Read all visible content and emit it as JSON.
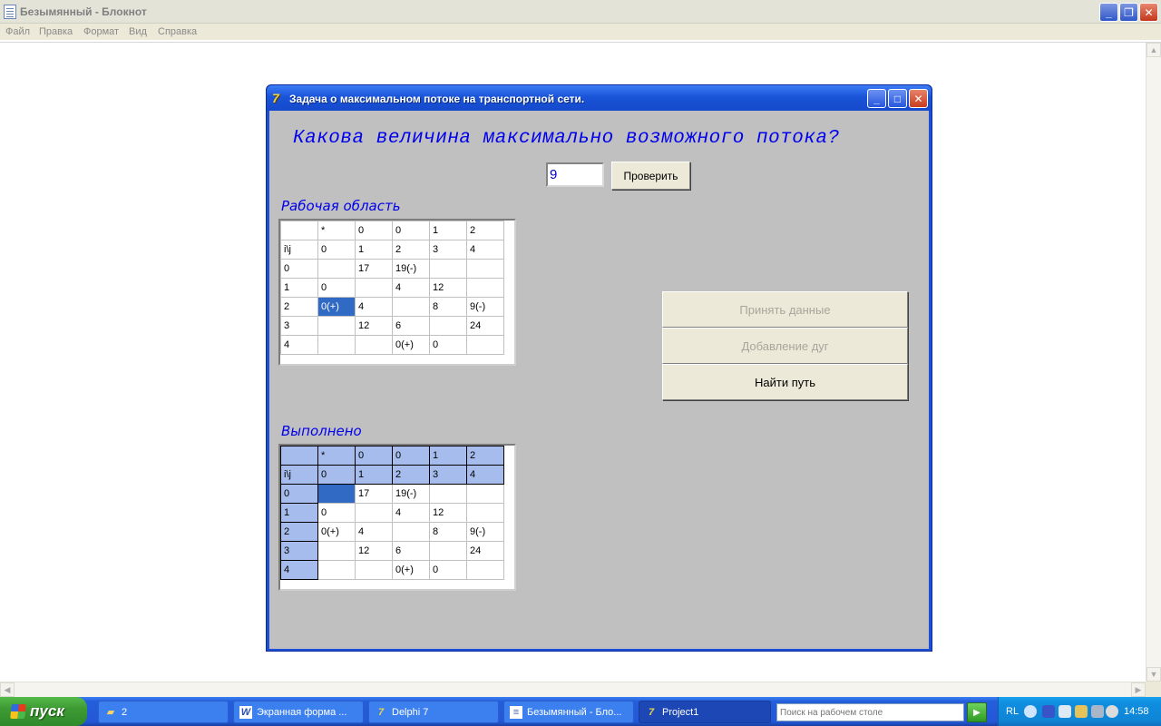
{
  "notepad": {
    "title": "Безымянный - Блокнот",
    "menu": [
      "Файл",
      "Правка",
      "Формат",
      "Вид",
      "Справка"
    ]
  },
  "dialog": {
    "title": "Задача о максимальном потоке  на транспортной сети.",
    "question": "Какова величина максимально возможного потока?",
    "answer_value": "9",
    "check_button": "Проверить",
    "work_label": "Рабочая область",
    "done_label": "Выполнено",
    "buttons": {
      "accept": "Принять данные",
      "add_arcs": "Добавление дуг",
      "find_path": "Найти путь"
    },
    "work_grid": [
      [
        "",
        "*",
        "0",
        "0",
        "1",
        "2"
      ],
      [
        "i\\j",
        "0",
        "1",
        "2",
        "3",
        "4"
      ],
      [
        "0",
        "",
        "17",
        "19(-)",
        "",
        ""
      ],
      [
        "1",
        "0",
        "",
        "4",
        "12",
        ""
      ],
      [
        "2",
        "0(+)",
        "4",
        "",
        "8",
        "9(-)"
      ],
      [
        "3",
        "",
        "12",
        "6",
        "",
        "24"
      ],
      [
        "4",
        "",
        "",
        "0(+)",
        "0",
        ""
      ]
    ],
    "done_grid": [
      [
        "",
        "*",
        "0",
        "0",
        "1",
        "2"
      ],
      [
        "i\\j",
        "0",
        "1",
        "2",
        "3",
        "4"
      ],
      [
        "0",
        "",
        "17",
        "19(-)",
        "",
        ""
      ],
      [
        "1",
        "0",
        "",
        "4",
        "12",
        ""
      ],
      [
        "2",
        "0(+)",
        "4",
        "",
        "8",
        "9(-)"
      ],
      [
        "3",
        "",
        "12",
        "6",
        "",
        "24"
      ],
      [
        "4",
        "",
        "",
        "0(+)",
        "0",
        ""
      ]
    ]
  },
  "taskbar": {
    "start_label": "пуск",
    "tasks": [
      "2",
      "Экранная форма ...",
      "Delphi 7",
      "Безымянный - Бло...",
      "Project1"
    ],
    "search_placeholder": "Поиск на рабочем столе",
    "language": "RL",
    "clock": "14:58"
  },
  "colors": {
    "dialog_client": "#c0c0c0",
    "question_text": "#0000ee",
    "fixed_cell": "#a6bcec",
    "selected_cell": "#316ac5",
    "xp_blue": "#245edb"
  }
}
